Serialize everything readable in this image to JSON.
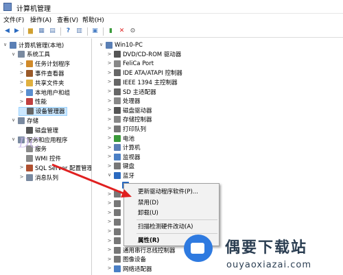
{
  "window": {
    "title": "计算机管理"
  },
  "menu": [
    "文件(F)",
    "操作(A)",
    "查看(V)",
    "帮助(H)"
  ],
  "left_tree": [
    {
      "label": "计算机管理(本地)",
      "level": 0,
      "exp": "∨",
      "icon": "computer-icon",
      "color": "#5a7fb5"
    },
    {
      "label": "系统工具",
      "level": 1,
      "exp": "∨",
      "icon": "tools-icon",
      "color": "#7a8aa0"
    },
    {
      "label": "任务计划程序",
      "level": 2,
      "exp": ">",
      "icon": "clock-icon",
      "color": "#d08a2a"
    },
    {
      "label": "事件查看器",
      "level": 2,
      "exp": ">",
      "icon": "event-viewer-icon",
      "color": "#9a5a2a"
    },
    {
      "label": "共享文件夹",
      "level": 2,
      "exp": ">",
      "icon": "shared-folder-icon",
      "color": "#e0b040"
    },
    {
      "label": "本地用户和组",
      "level": 2,
      "exp": ">",
      "icon": "users-icon",
      "color": "#5a8fd0"
    },
    {
      "label": "性能",
      "level": 2,
      "exp": ">",
      "icon": "performance-icon",
      "color": "#c04040"
    },
    {
      "label": "设备管理器",
      "level": 2,
      "exp": "",
      "icon": "device-manager-icon",
      "color": "#666666",
      "selected": true
    },
    {
      "label": "存储",
      "level": 1,
      "exp": "∨",
      "icon": "storage-icon",
      "color": "#7a8aa0"
    },
    {
      "label": "磁盘管理",
      "level": 2,
      "exp": "",
      "icon": "disk-icon",
      "color": "#555555"
    },
    {
      "label": "服务和应用程序",
      "level": 1,
      "exp": "∨",
      "icon": "services-apps-icon",
      "color": "#7a8aa0"
    },
    {
      "label": "服务",
      "level": 2,
      "exp": "",
      "icon": "services-icon",
      "color": "#8a8a8a"
    },
    {
      "label": "WMI 控件",
      "level": 2,
      "exp": "",
      "icon": "wmi-icon",
      "color": "#8a8a8a"
    },
    {
      "label": "SQL Server 配置管理器",
      "level": 2,
      "exp": ">",
      "icon": "sql-server-icon",
      "color": "#b05030"
    },
    {
      "label": "消息队列",
      "level": 2,
      "exp": ">",
      "icon": "message-queue-icon",
      "color": "#7a8aa0"
    }
  ],
  "right_tree": [
    {
      "label": "Win10-PC",
      "level": 0,
      "exp": "∨",
      "icon": "pc-icon",
      "color": "#5a7fb5"
    },
    {
      "label": "DVD/CD-ROM 驱动器",
      "level": 1,
      "exp": ">",
      "icon": "dvd-icon",
      "color": "#555555"
    },
    {
      "label": "FeliCa Port",
      "level": 1,
      "exp": ">",
      "icon": "port-icon",
      "color": "#888888"
    },
    {
      "label": "IDE ATA/ATAPI 控制器",
      "level": 1,
      "exp": ">",
      "icon": "ide-icon",
      "color": "#666666"
    },
    {
      "label": "IEEE 1394 主控制器",
      "level": 1,
      "exp": ">",
      "icon": "ieee1394-icon",
      "color": "#666666"
    },
    {
      "label": "SD 主适配器",
      "level": 1,
      "exp": ">",
      "icon": "sd-icon",
      "color": "#666666"
    },
    {
      "label": "处理器",
      "level": 1,
      "exp": ">",
      "icon": "processor-icon",
      "color": "#888888"
    },
    {
      "label": "磁盘驱动器",
      "level": 1,
      "exp": ">",
      "icon": "disk-drive-icon",
      "color": "#555555"
    },
    {
      "label": "存储控制器",
      "level": 1,
      "exp": ">",
      "icon": "storage-controller-icon",
      "color": "#888888"
    },
    {
      "label": "打印队列",
      "level": 1,
      "exp": ">",
      "icon": "printer-icon",
      "color": "#777777"
    },
    {
      "label": "电池",
      "level": 1,
      "exp": ">",
      "icon": "battery-icon",
      "color": "#3a9a3a"
    },
    {
      "label": "计算机",
      "level": 1,
      "exp": ">",
      "icon": "computer-icon",
      "color": "#5a7fb5"
    },
    {
      "label": "监视器",
      "level": 1,
      "exp": ">",
      "icon": "monitor-icon",
      "color": "#4a7fc5"
    },
    {
      "label": "键盘",
      "level": 1,
      "exp": ">",
      "icon": "keyboard-icon",
      "color": "#777777"
    },
    {
      "label": "蓝牙",
      "level": 1,
      "exp": "∨",
      "icon": "bluetooth-icon",
      "color": "#2a6ac0"
    },
    {
      "label": "",
      "level": 2,
      "exp": "",
      "icon": "bluetooth-device-icon",
      "color": "#2a6ac0"
    },
    {
      "label": "",
      "level": 1,
      "exp": ">",
      "icon": "device-icon",
      "color": "#777777"
    },
    {
      "label": "",
      "level": 1,
      "exp": ">",
      "icon": "device-icon",
      "color": "#777777"
    },
    {
      "label": "",
      "level": 1,
      "exp": ">",
      "icon": "device-icon",
      "color": "#777777"
    },
    {
      "label": "",
      "level": 1,
      "exp": ">",
      "icon": "device-icon",
      "color": "#777777"
    },
    {
      "label": "",
      "level": 1,
      "exp": ">",
      "icon": "device-icon",
      "color": "#777777"
    },
    {
      "label": "",
      "level": 1,
      "exp": ">",
      "icon": "device-icon",
      "color": "#777777"
    },
    {
      "label": "通用串行总线控制器",
      "level": 1,
      "exp": ">",
      "icon": "usb-icon",
      "color": "#777777"
    },
    {
      "label": "图像设备",
      "level": 1,
      "exp": ">",
      "icon": "camera-icon",
      "color": "#777777"
    },
    {
      "label": "网络适配器",
      "level": 1,
      "exp": ">",
      "icon": "network-icon",
      "color": "#4a7fc5"
    }
  ],
  "context_menu": {
    "items": [
      "更新驱动程序软件(P)...",
      "禁用(D)",
      "卸载(U)",
      "扫描检测硬件改动(A)",
      "属性(R)"
    ]
  },
  "watermark": {
    "left_mark": "DC",
    "brand": "偶要下载站",
    "url": "ouyaoxiazai.com"
  },
  "colors": {
    "selection": "#cce8ff",
    "arrow": "#e02020",
    "brand_blue": "#2e7ae0"
  }
}
